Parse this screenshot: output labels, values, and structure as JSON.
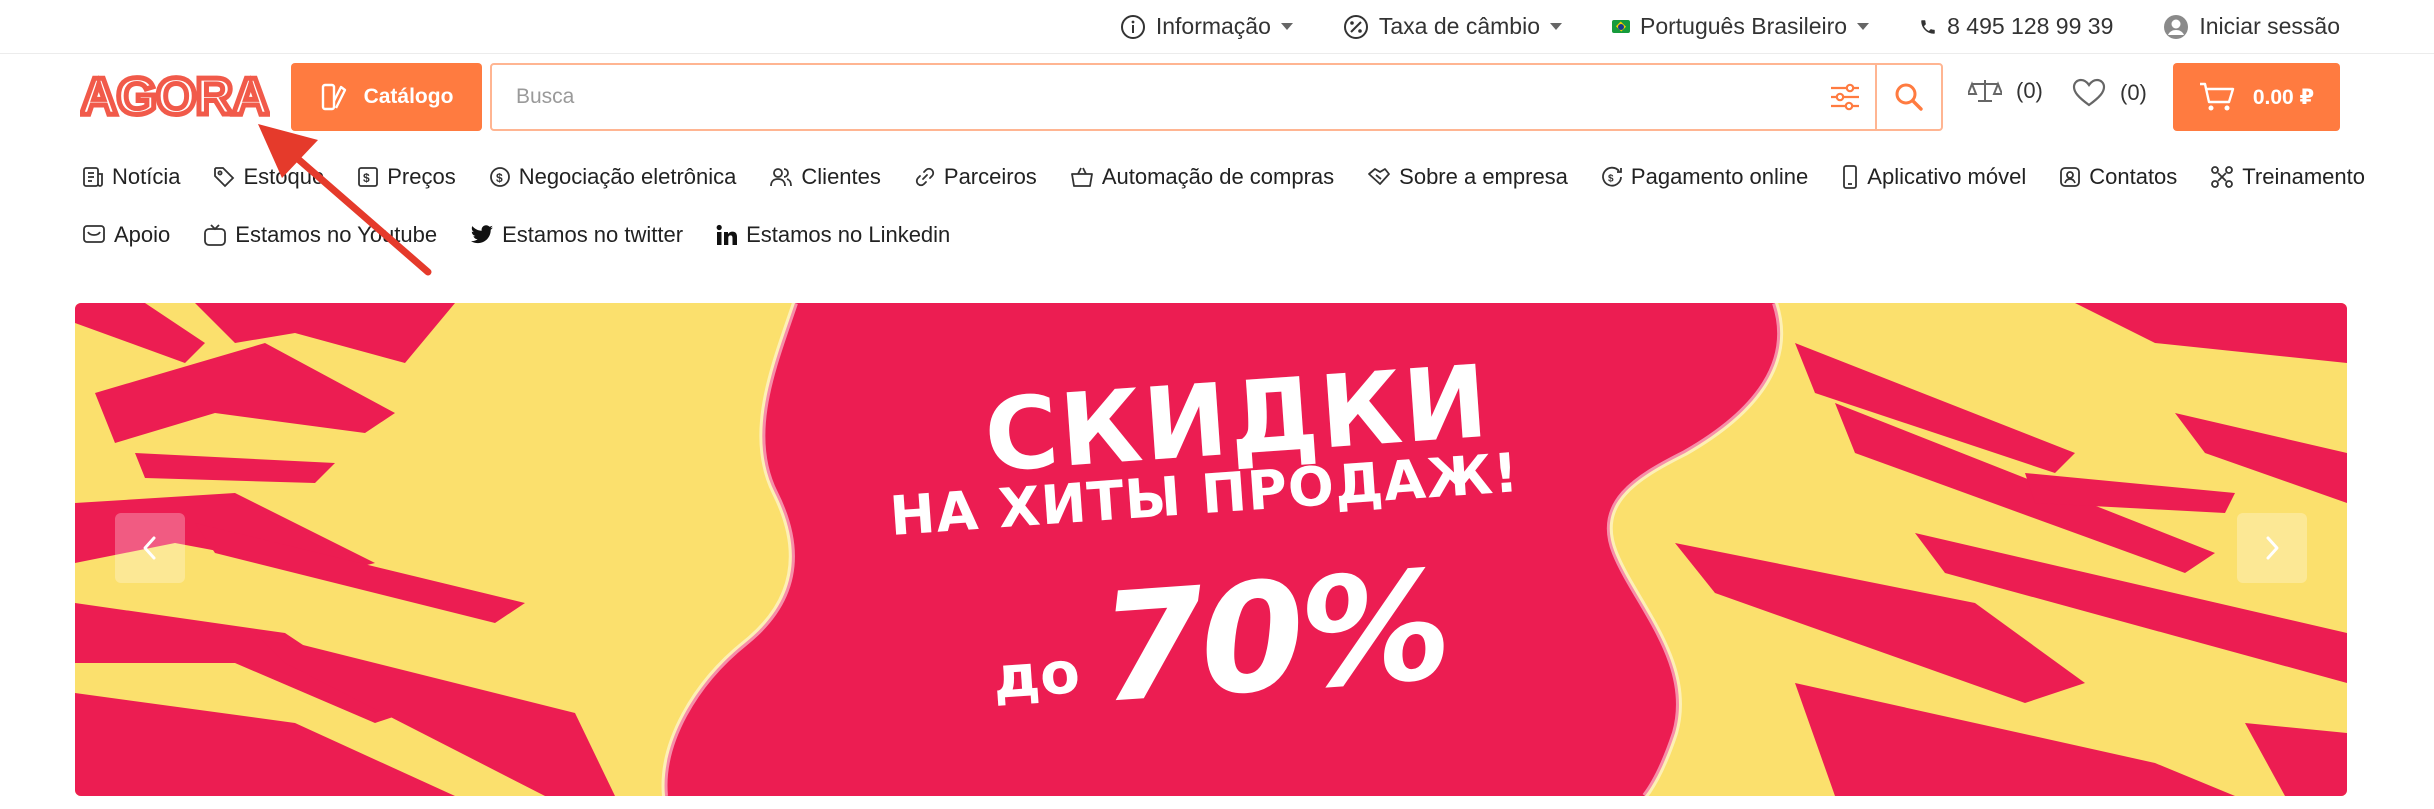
{
  "topbar": {
    "info_label": "Informação",
    "rate_label": "Taxa de câmbio",
    "language_label": "Português Brasileiro",
    "phone": "8 495 128 99 39",
    "login_label": "Iniciar sessão"
  },
  "header": {
    "logo_text": "AGORA",
    "catalog_label": "Catálogo",
    "search_placeholder": "Busca",
    "compare_count": "(0)",
    "favorites_count": "(0)",
    "cart_total": "0.00 ₽"
  },
  "nav": {
    "row1": [
      {
        "label": "Notícia",
        "icon": "news-icon"
      },
      {
        "label": "Estoque",
        "icon": "tag-icon"
      },
      {
        "label": "Preços",
        "icon": "price-list-icon"
      },
      {
        "label": "Negociação eletrônica",
        "icon": "coin-icon"
      },
      {
        "label": "Clientes",
        "icon": "users-icon"
      },
      {
        "label": "Parceiros",
        "icon": "link-icon"
      },
      {
        "label": "Automação de compras",
        "icon": "basket-icon"
      },
      {
        "label": "Sobre a empresa",
        "icon": "handshake-icon"
      },
      {
        "label": "Pagamento online",
        "icon": "payment-icon"
      },
      {
        "label": "Aplicativo móvel",
        "icon": "mobile-icon"
      },
      {
        "label": "Contatos",
        "icon": "contact-icon"
      },
      {
        "label": "Treinamento",
        "icon": "training-icon"
      }
    ],
    "row2": [
      {
        "label": "Apoio",
        "icon": "support-icon"
      },
      {
        "label": "Estamos no Youtube",
        "icon": "tv-icon"
      },
      {
        "label": "Estamos no twitter",
        "icon": "twitter-icon"
      },
      {
        "label": "Estamos no Linkedin",
        "icon": "linkedin-icon"
      }
    ]
  },
  "banner": {
    "line1": "СКИДКИ",
    "line2": "НА ХИТЫ ПРОДАЖ!",
    "prefix": "до",
    "percent": "70%"
  },
  "colors": {
    "accent": "#ff7b40",
    "banner_yellow": "#fbe06d",
    "banner_pink": "#ec1d52",
    "annotation_red": "#e53a2b"
  }
}
